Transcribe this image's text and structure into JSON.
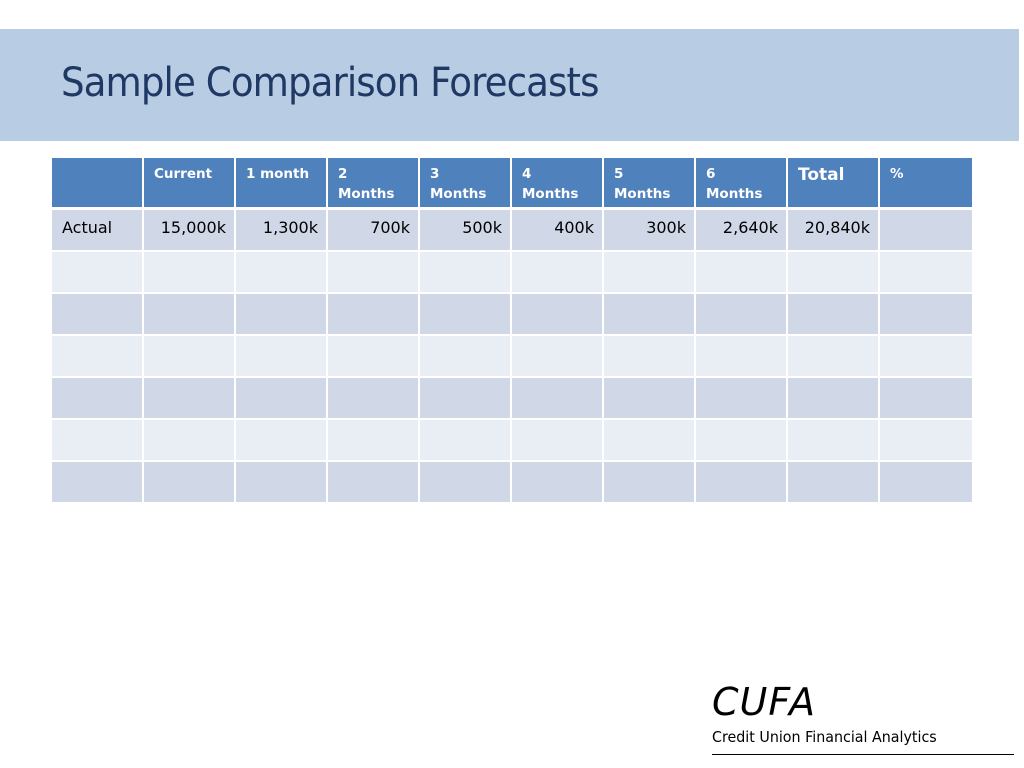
{
  "slide": {
    "title": "Sample Comparison Forecasts",
    "title_band_color": "#b8cce4",
    "title_color": "#1f3864"
  },
  "table": {
    "header_color": "#4f81bd",
    "row_colors": [
      "#d0d8e8",
      "#e9edf4"
    ],
    "columns": [
      {
        "line1": "",
        "line2": ""
      },
      {
        "line1": "Current",
        "line2": ""
      },
      {
        "line1": "1 month",
        "line2": ""
      },
      {
        "line1": "2",
        "line2": "Months"
      },
      {
        "line1": "3",
        "line2": "Months"
      },
      {
        "line1": "4",
        "line2": "Months"
      },
      {
        "line1": "5",
        "line2": "Months"
      },
      {
        "line1": "6",
        "line2": "Months"
      },
      {
        "line1": "Total",
        "line2": ""
      },
      {
        "line1": "%",
        "line2": ""
      }
    ],
    "rows": [
      [
        "Actual",
        "15,000k",
        "1,300k",
        "700k",
        "500k",
        "400k",
        "300k",
        "2,640k",
        "20,840k",
        ""
      ],
      [
        "",
        "",
        "",
        "",
        "",
        "",
        "",
        "",
        "",
        ""
      ],
      [
        "",
        "",
        "",
        "",
        "",
        "",
        "",
        "",
        "",
        ""
      ],
      [
        "",
        "",
        "",
        "",
        "",
        "",
        "",
        "",
        "",
        ""
      ],
      [
        "",
        "",
        "",
        "",
        "",
        "",
        "",
        "",
        "",
        ""
      ],
      [
        "",
        "",
        "",
        "",
        "",
        "",
        "",
        "",
        "",
        ""
      ],
      [
        "",
        "",
        "",
        "",
        "",
        "",
        "",
        "",
        "",
        ""
      ]
    ]
  },
  "logo": {
    "mark": "CUFA",
    "subtitle": "Credit Union Financial Analytics"
  }
}
